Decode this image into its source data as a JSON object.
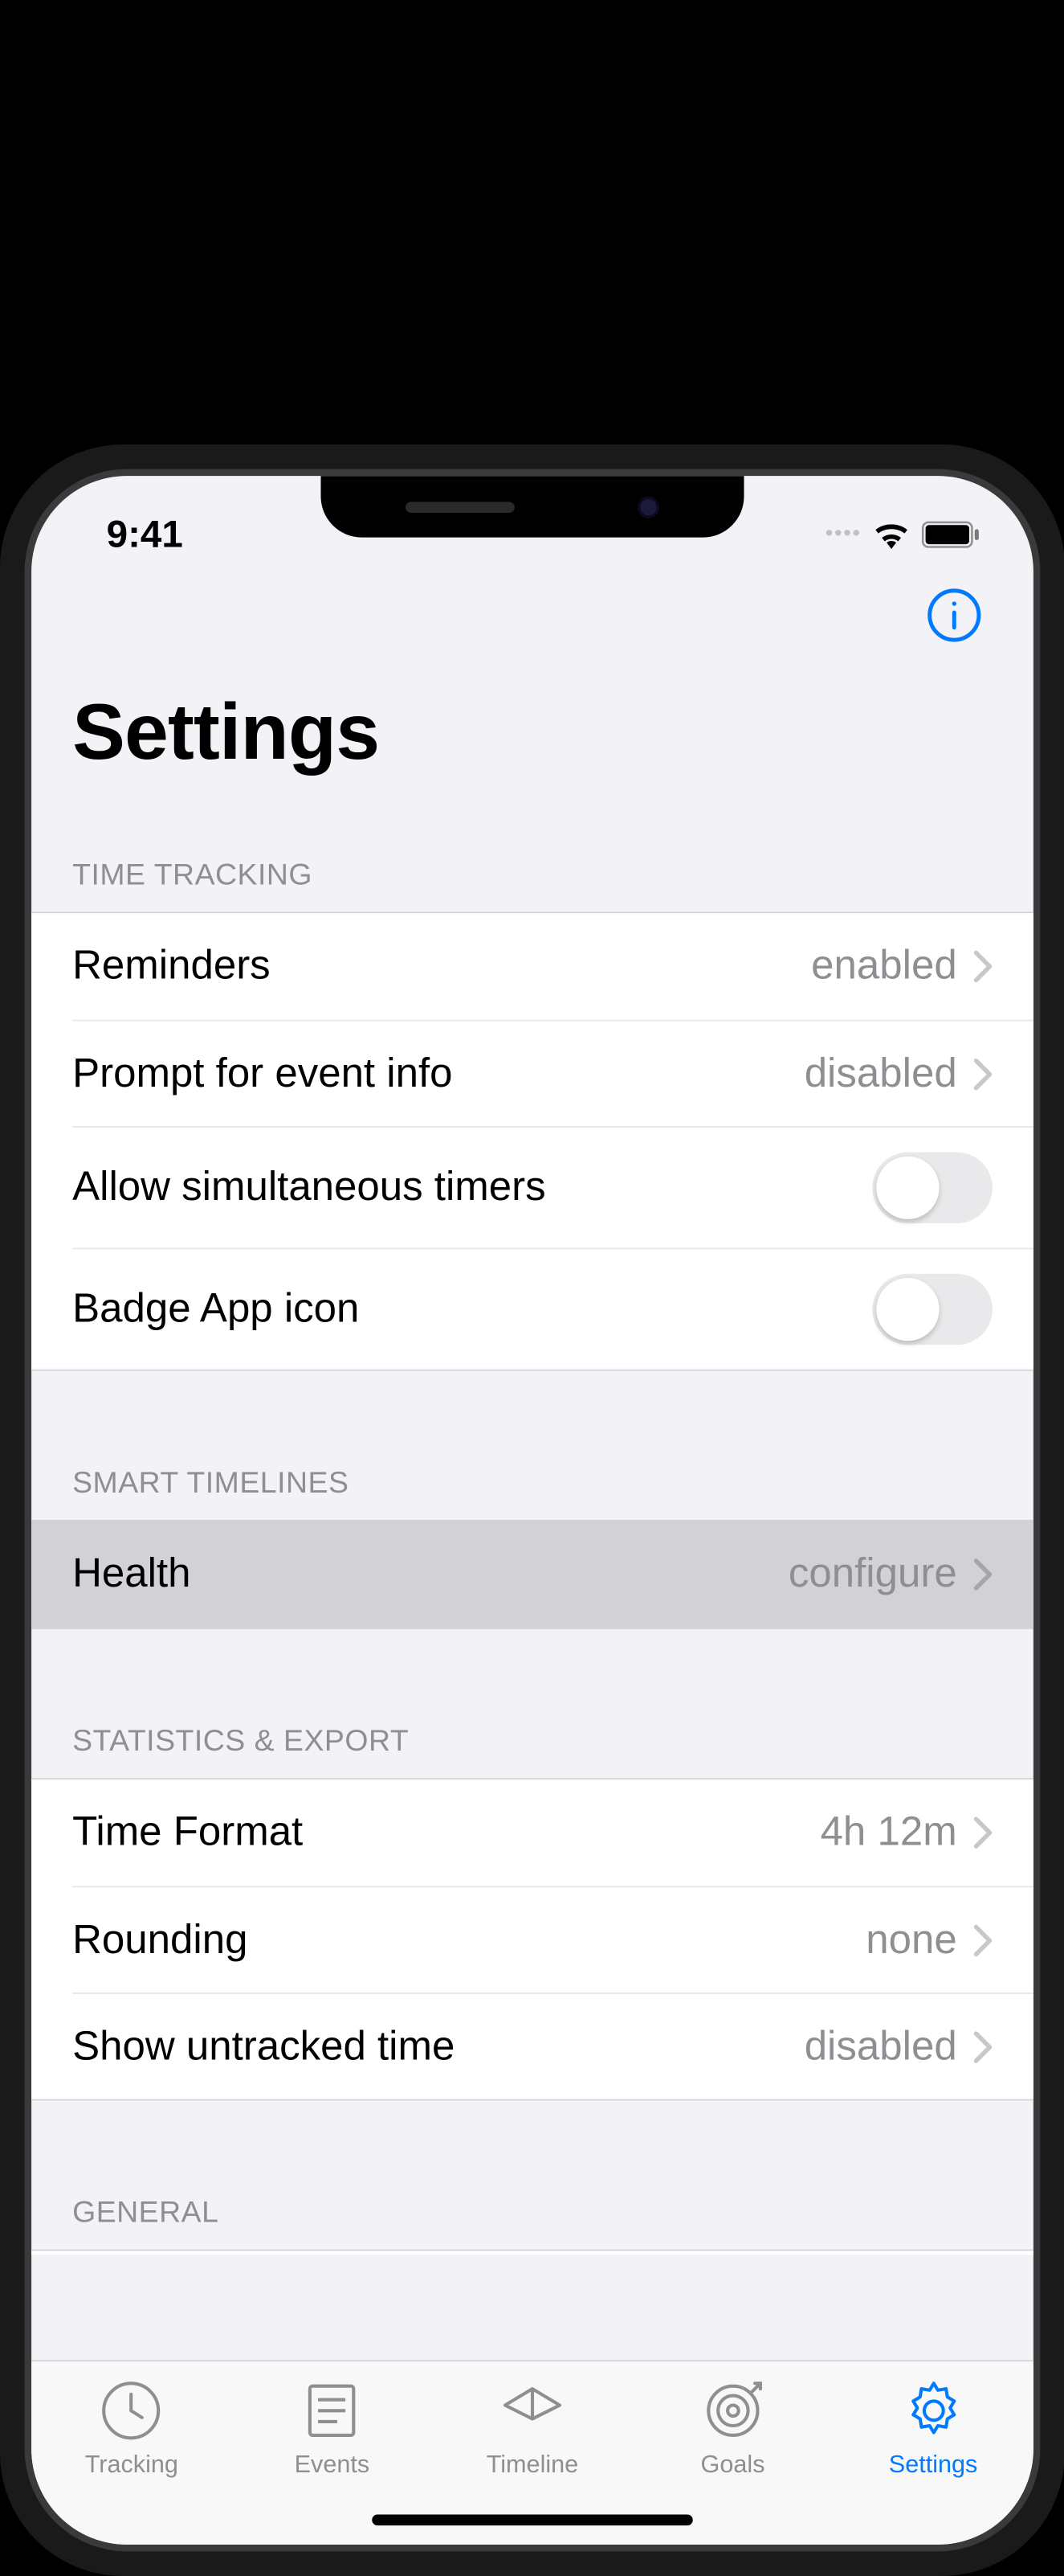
{
  "status": {
    "time": "9:41"
  },
  "header": {
    "title": "Settings"
  },
  "sections": {
    "timeTracking": {
      "header": "TIME TRACKING",
      "rows": {
        "reminders": {
          "label": "Reminders",
          "value": "enabled"
        },
        "prompt": {
          "label": "Prompt for event info",
          "value": "disabled"
        },
        "simultaneous": {
          "label": "Allow simultaneous timers"
        },
        "badge": {
          "label": "Badge App icon"
        }
      }
    },
    "smartTimelines": {
      "header": "SMART TIMELINES",
      "rows": {
        "health": {
          "label": "Health",
          "value": "configure"
        }
      }
    },
    "statsExport": {
      "header": "STATISTICS & EXPORT",
      "rows": {
        "timeFormat": {
          "label": "Time Format",
          "value": "4h 12m"
        },
        "rounding": {
          "label": "Rounding",
          "value": "none"
        },
        "untracked": {
          "label": "Show untracked time",
          "value": "disabled"
        }
      }
    },
    "general": {
      "header": "GENERAL"
    }
  },
  "tabs": {
    "tracking": "Tracking",
    "events": "Events",
    "timeline": "Timeline",
    "goals": "Goals",
    "settings": "Settings"
  }
}
